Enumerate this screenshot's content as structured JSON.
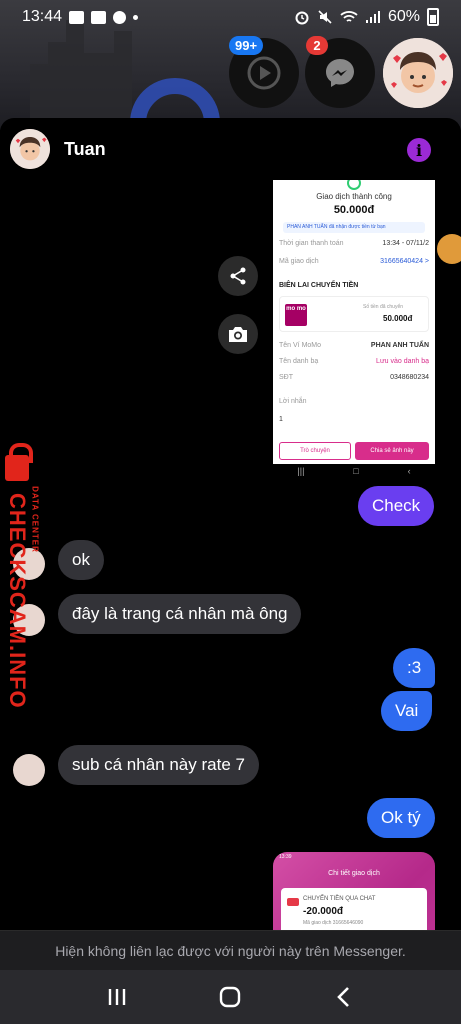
{
  "status_bar": {
    "time": "13:44",
    "battery": "60%"
  },
  "chat_heads": {
    "play_badge": "99+",
    "messenger_badge": "2"
  },
  "conversation": {
    "contact_name": "Tuan"
  },
  "shared_image_1": {
    "title": "Giao dịch thành công",
    "amount": "50.000đ",
    "note": "PHAN ANH TUẤN đã nhận được tiền từ bạn",
    "time_label": "Thời gian thanh toán",
    "time_value": "13:34 - 07/11/2",
    "id_label": "Mã giao dịch",
    "id_value": "31665640424 >",
    "receipt_heading": "BIÊN LAI CHUYỂN TIỀN",
    "momo_logo": "mo mo",
    "amount_label": "Số tiền đã chuyển",
    "amount_value": "50.000đ",
    "wallet_label": "Tên Ví MoMo",
    "wallet_value": "PHAN ANH TUẤN",
    "contact_label": "Tên danh bạ",
    "contact_value": "Lưu vào danh bạ",
    "phone_label": "SĐT",
    "phone_value": "0348680234",
    "message_label": "Lời nhắn",
    "message_value": "1",
    "btn_chat": "Trò chuyện",
    "btn_share": "Chia sẻ ảnh này"
  },
  "messages": [
    {
      "side": "out",
      "text": "Check"
    },
    {
      "side": "in",
      "text": "ok"
    },
    {
      "side": "in",
      "text": "đây là trang cá nhân mà ông"
    },
    {
      "side": "out",
      "text": ":3"
    },
    {
      "side": "out",
      "text": "Vai"
    },
    {
      "side": "in",
      "text": "sub cá nhân này rate 7"
    },
    {
      "side": "out",
      "text": "Ok tý"
    }
  ],
  "shared_image_2": {
    "status_time": "13:39",
    "heading": "Chi tiết giao dịch",
    "item_title": "CHUYỂN TIỀN QUA CHAT",
    "item_amount": "-20.000đ",
    "item_id": "Mã giao dịch 31665646090"
  },
  "watermark": {
    "brand": "CHECKSCAM.INFO",
    "sub": "DATA CENTER"
  },
  "notice": "Hiện không liên lạc được với người này trên Messenger.",
  "colors": {
    "outgoing_purple": "#6a3ef0",
    "outgoing_blue": "#2e6bf0",
    "incoming": "#333338",
    "info_icon": "#9b2ad6",
    "watermark": "#e1251b"
  }
}
